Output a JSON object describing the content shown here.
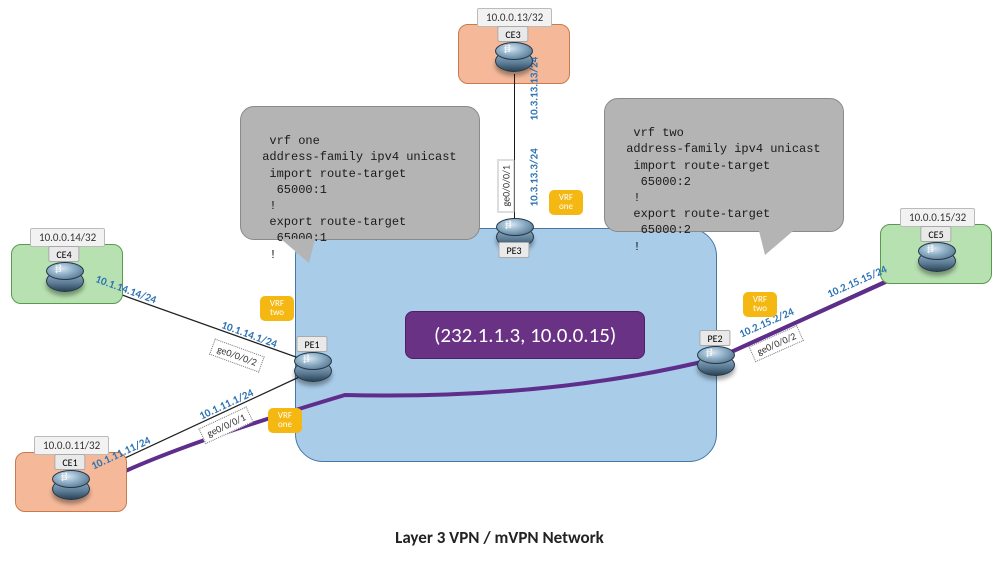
{
  "title": "Layer 3 VPN / mVPN Network",
  "sg_label": "(232.1.1.3, 10.0.0.15)",
  "routers": {
    "ce1": {
      "name": "CE1",
      "loopback": "10.0.0.11/32"
    },
    "ce3": {
      "name": "CE3",
      "loopback": "10.0.0.13/32"
    },
    "ce4": {
      "name": "CE4",
      "loopback": "10.0.0.14/32"
    },
    "ce5": {
      "name": "CE5",
      "loopback": "10.0.0.15/32"
    },
    "pe1": {
      "name": "PE1"
    },
    "pe2": {
      "name": "PE2"
    },
    "pe3": {
      "name": "PE3"
    }
  },
  "links": {
    "ce3_pe3": {
      "ce_ip": "10.3.13.13/24",
      "pe_ip": "10.3.13.3/24",
      "pe_intf": "ge0/0/0/1",
      "vrf": "VRF one"
    },
    "ce4_pe1": {
      "ce_ip": "10.1.14.14/24",
      "pe_ip": "10.1.14.1/24",
      "pe_intf": "ge0/0/0/2",
      "vrf": "VRF two"
    },
    "ce1_pe1": {
      "ce_ip": "10.1.11.11/24",
      "pe_ip": "10.1.11.1/24",
      "pe_intf": "ge0/0/0/1",
      "vrf": "VRF one"
    },
    "ce5_pe2": {
      "ce_ip": "10.2.15.15/24",
      "pe_ip": "10.2.15.2/24",
      "pe_intf": "ge0/0/0/2",
      "vrf": "VRF two"
    }
  },
  "vrf_configs": {
    "one": "vrf one\n address-family ipv4 unicast\n  import route-target\n   65000:1\n  !\n  export route-target\n   65000:1\n  !",
    "two": "vrf two\n address-family ipv4 unicast\n  import route-target\n   65000:2\n  !\n  export route-target\n   65000:2\n  !"
  },
  "vrf_tag_lines": {
    "vrf": "VRF",
    "one": "one",
    "two": "two"
  }
}
